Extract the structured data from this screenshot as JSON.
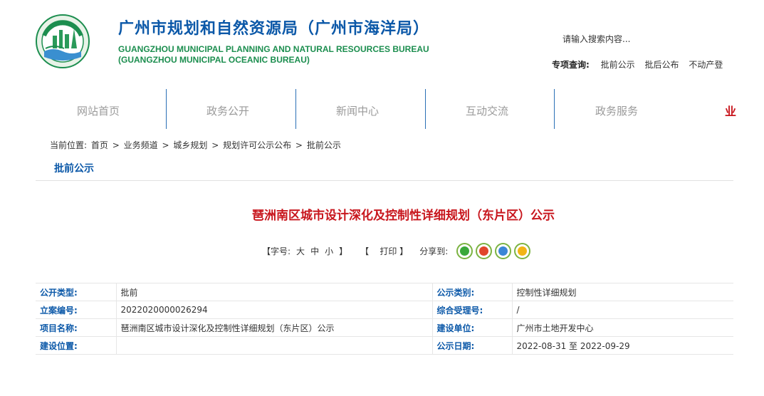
{
  "header": {
    "title_cn": "广州市规划和自然资源局（广州市海洋局）",
    "title_en_line1": "GUANGZHOU MUNICIPAL PLANNING AND NATURAL RESOURCES BUREAU",
    "title_en_line2": "(GUANGZHOU MUNICIPAL OCEANIC BUREAU)",
    "search_placeholder": "请输入搜索内容...",
    "special_label": "专项查询:",
    "special_links": [
      "批前公示",
      "批后公布",
      "不动产登"
    ]
  },
  "nav": {
    "items": [
      "网站首页",
      "政务公开",
      "新闻中心",
      "互动交流",
      "政务服务"
    ],
    "more": "业"
  },
  "breadcrumb": {
    "label": "当前位置:",
    "items": [
      "首页",
      "业务频道",
      "城乡规划",
      "规划许可公示公布",
      "批前公示"
    ],
    "separator": ">"
  },
  "section_title": "批前公示",
  "article": {
    "title": "琶洲南区城市设计深化及控制性详细规划（东片区）公示",
    "font_label": "【字号:",
    "font_sizes": [
      "大",
      "中",
      "小"
    ],
    "font_close": "】",
    "print": "【    打印 】",
    "share_label": "分享到:",
    "share_icons": [
      "wechat-icon",
      "weibo-icon",
      "qq-icon",
      "qzone-icon"
    ]
  },
  "colors": {
    "brand_blue": "#0b58a8",
    "title_red": "#c8161d",
    "english_green": "#1c8e4f"
  },
  "info_table": [
    {
      "k1": "公开类型:",
      "v1": "批前",
      "k2": "公示类别:",
      "v2": "控制性详细规划"
    },
    {
      "k1": "立案编号:",
      "v1": "2022020000026294",
      "k2": "综合受理号:",
      "v2": "/"
    },
    {
      "k1": "项目名称:",
      "v1": "琶洲南区城市设计深化及控制性详细规划（东片区）公示",
      "k2": "建设单位:",
      "v2": "广州市土地开发中心"
    },
    {
      "k1": "建设位置:",
      "v1": "",
      "k2": "公示日期:",
      "v2": "2022-08-31 至 2022-09-29"
    }
  ]
}
